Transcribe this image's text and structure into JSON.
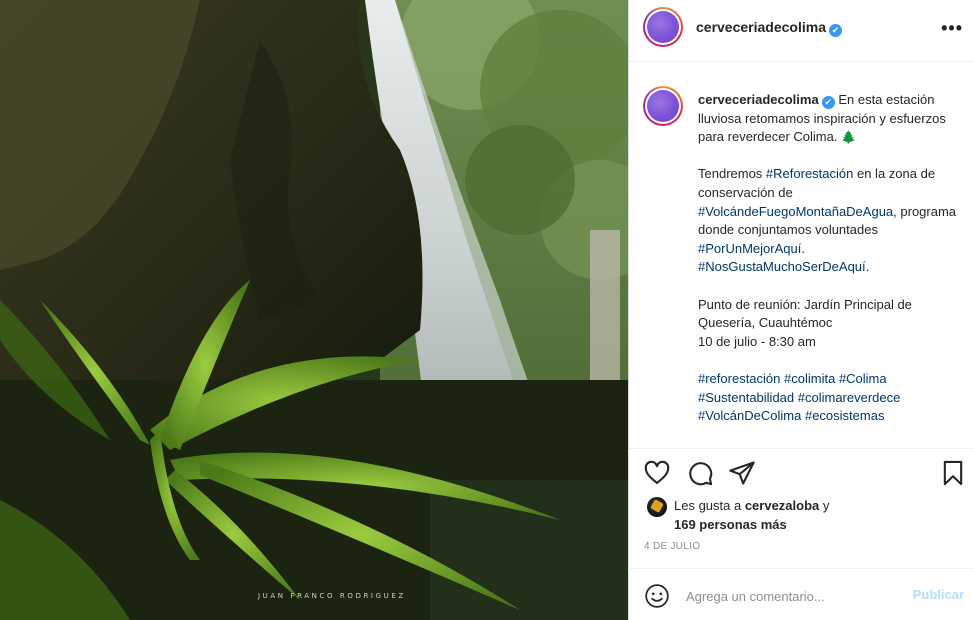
{
  "photo": {
    "credit": "JUAN FRANCO RODRIGUEZ"
  },
  "header": {
    "username": "cerveceriadecolima",
    "verified_mark": "✔",
    "more_label": "•••"
  },
  "caption": {
    "username": "cerveceriadecolima",
    "verified_mark": "✔",
    "p1_text": "En esta estación lluviosa retomamos inspiración y esfuerzos para reverdecer Colima.",
    "p1_emoji": "🌲",
    "p2_a": "Tendremos ",
    "p2_tag1": "#Reforestación",
    "p2_b": " en la zona de conservación de ",
    "p2_tag2": "#VolcándeFuegoMontañaDeAgua",
    "p2_c": ", programa donde conjuntamos voluntades ",
    "p2_tag3": "#PorUnMejorAquí",
    "p2_d": ". ",
    "p2_tag4": "#NosGustaMuchoSerDeAquí",
    "p2_e": ".",
    "p3_line1": "Punto de reunión: Jardín Principal de Quesería, Cuauhtémoc",
    "p3_line2": "10 de julio - 8:30 am",
    "hashtags": [
      "#reforestación",
      "#colimita",
      "#Colima",
      "#Sustentabilidad",
      "#colimareverdece",
      "#VolcánDeColima",
      "#ecosistemas"
    ]
  },
  "actions": {
    "icons": [
      "heart-icon",
      "comment-icon",
      "share-icon",
      "bookmark-icon"
    ]
  },
  "likes": {
    "prefix": "Les gusta a ",
    "liker": "cervezaloba",
    "middle": " y",
    "count_text": "169 personas más"
  },
  "date": "4 DE JULIO",
  "comment": {
    "placeholder": "Agrega un comentario...",
    "publish_label": "Publicar"
  },
  "colors": {
    "link": "#00376b",
    "publish_disabled": "#b2dffc",
    "muted": "#8e8e8e"
  }
}
